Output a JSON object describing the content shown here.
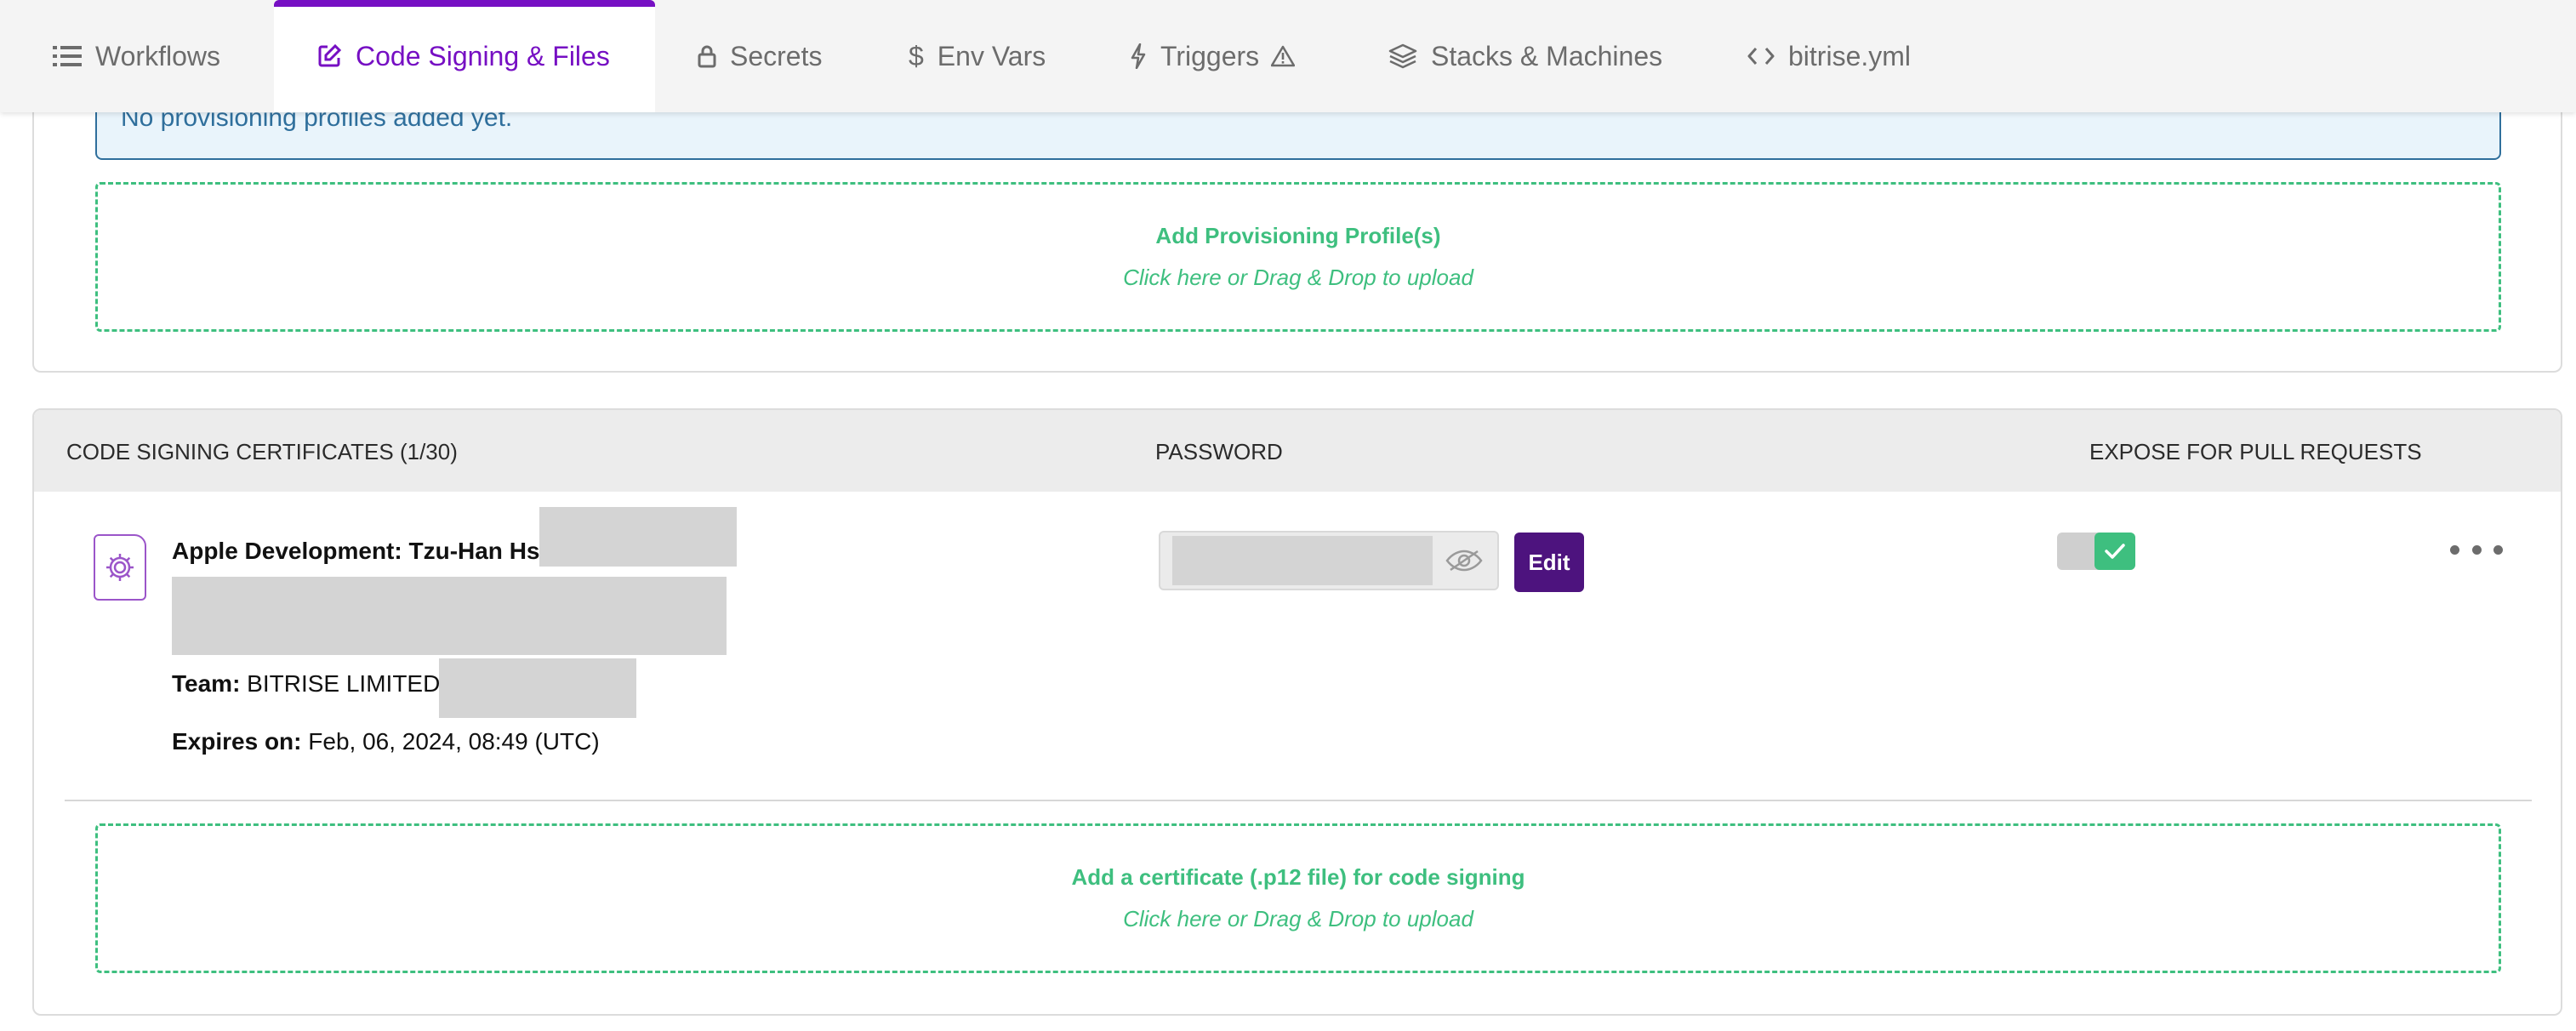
{
  "tabs": [
    {
      "label": "Workflows",
      "icon": "list-icon",
      "active": false
    },
    {
      "label": "Code Signing & Files",
      "icon": "edit-square-icon",
      "active": true
    },
    {
      "label": "Secrets",
      "icon": "lock-icon",
      "active": false
    },
    {
      "label": "Env Vars",
      "icon": "dollar-icon",
      "active": false
    },
    {
      "label": "Triggers",
      "icon": "lightning-icon",
      "active": false,
      "badge_icon": "warning-icon"
    },
    {
      "label": "Stacks & Machines",
      "icon": "layers-icon",
      "active": false
    },
    {
      "label": "bitrise.yml",
      "icon": "code-icon",
      "active": false
    }
  ],
  "provisioning": {
    "empty_notice": "No provisioning profiles added yet.",
    "add_title": "Add Provisioning Profile(s)",
    "add_hint": "Click here or Drag & Drop to upload"
  },
  "certificates": {
    "header": {
      "name_col": "CODE SIGNING CERTIFICATES (1/30)",
      "password_col": "PASSWORD",
      "expose_col": "EXPOSE FOR PULL REQUESTS"
    },
    "item": {
      "name": "Apple Development: Tzu-Han Hsu",
      "team_label": "Team:",
      "team_value": "BITRISE LIMITED (",
      "expires_label": "Expires on:",
      "expires_value": "Feb, 06, 2024, 08:49 (UTC)",
      "edit_label": "Edit",
      "expose_enabled": true
    },
    "add_title": "Add a certificate (.p12 file) for code signing",
    "add_hint": "Click here or Drag & Drop to upload"
  },
  "colors": {
    "accent": "#760fc3",
    "edit_button": "#4d137e",
    "success": "#3ebf7f",
    "info": "#2f6f9c"
  }
}
